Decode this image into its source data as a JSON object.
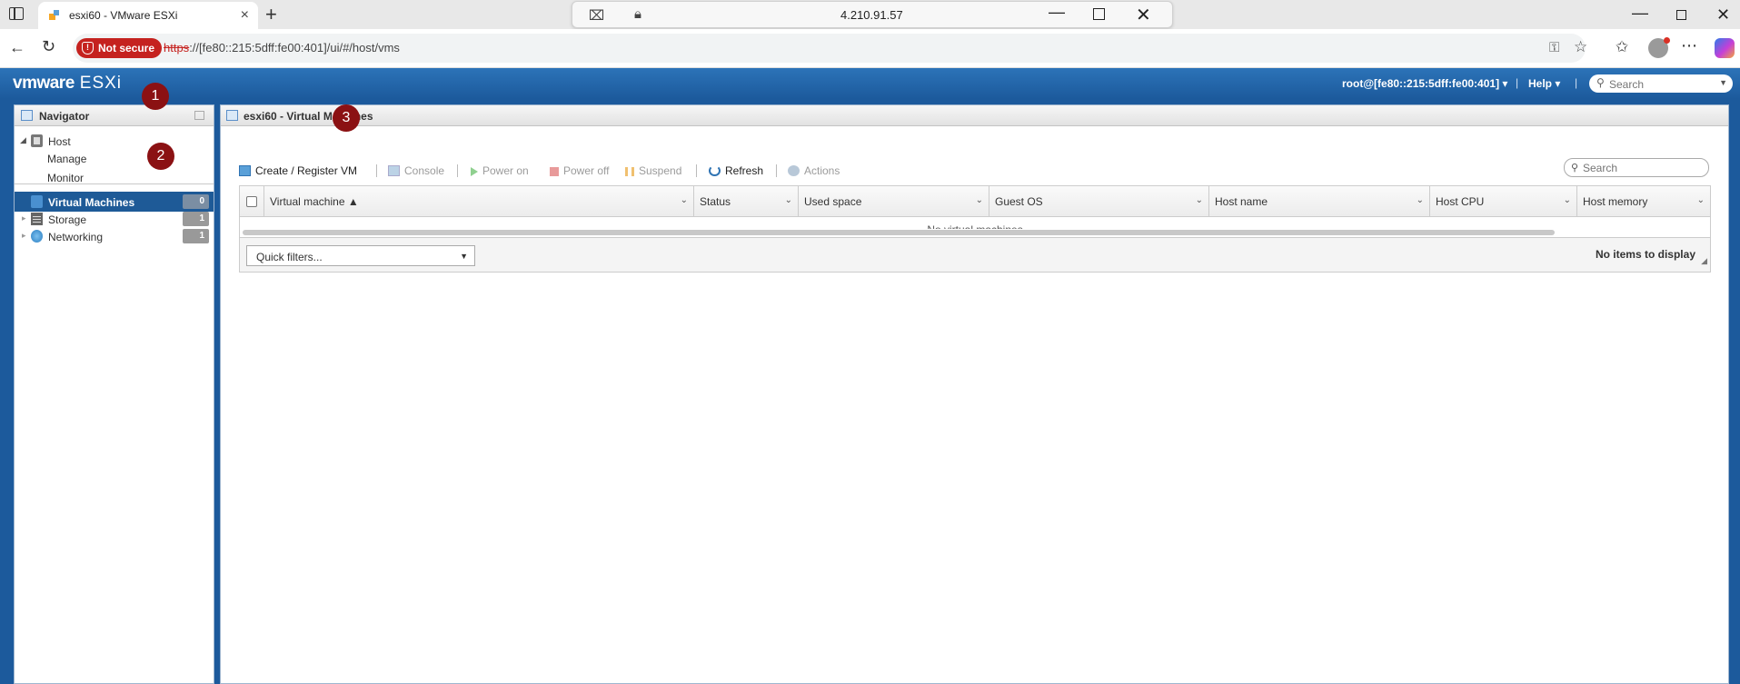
{
  "browser": {
    "tab_title": "esxi60 - VMware ESXi",
    "center_host": "4.210.91.57",
    "security_label": "Not secure",
    "url_scheme": "https",
    "url_rest": "://[fe80::215:5dff:fe00:401]/ui/#/host/vms"
  },
  "header": {
    "logo_vm": "vmware",
    "logo_product": "ESXi",
    "user": "root@[fe80::215:5dff:fe00:401] ▾",
    "help": "Help ▾",
    "separator": "|",
    "search_placeholder": "Search"
  },
  "navigator": {
    "title": "Navigator",
    "host": "Host",
    "manage": "Manage",
    "monitor": "Monitor",
    "items": [
      {
        "label": "Virtual Machines",
        "count": "0"
      },
      {
        "label": "Storage",
        "count": "1"
      },
      {
        "label": "Networking",
        "count": "1"
      }
    ]
  },
  "markers": [
    "1",
    "2",
    "3"
  ],
  "content": {
    "title": "esxi60 - Virtual Machines",
    "toolbar": {
      "create": "Create / Register VM",
      "console": "Console",
      "power_on": "Power on",
      "power_off": "Power off",
      "suspend": "Suspend",
      "refresh": "Refresh",
      "actions": "Actions"
    },
    "search_placeholder": "Search",
    "columns": [
      "Virtual machine ▲",
      "Status",
      "Used space",
      "Guest OS",
      "Host name",
      "Host CPU",
      "Host memory"
    ],
    "empty_message": "No virtual machines",
    "quick_filters": "Quick filters...",
    "items_status": "No items to display"
  }
}
